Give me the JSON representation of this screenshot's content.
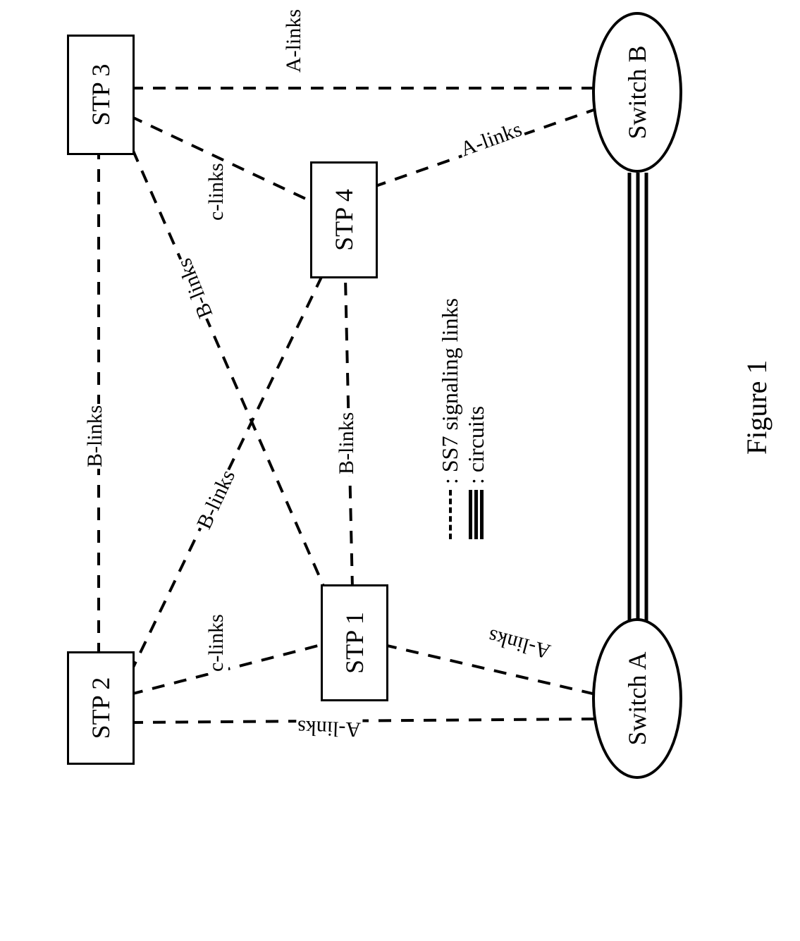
{
  "chart_data": {
    "type": "diagram",
    "title": "Figure 1",
    "nodes": [
      {
        "id": "stp1",
        "label": "STP 1",
        "shape": "rect"
      },
      {
        "id": "stp2",
        "label": "STP 2",
        "shape": "rect"
      },
      {
        "id": "stp3",
        "label": "STP 3",
        "shape": "rect"
      },
      {
        "id": "stp4",
        "label": "STP 4",
        "shape": "rect"
      },
      {
        "id": "switchA",
        "label": "Switch A",
        "shape": "ellipse"
      },
      {
        "id": "switchB",
        "label": "Switch B",
        "shape": "ellipse"
      }
    ],
    "edges": [
      {
        "from": "stp2",
        "to": "stp3",
        "type": "dashed",
        "label": "B-links"
      },
      {
        "from": "stp2",
        "to": "stp4",
        "type": "dashed",
        "label": "B-links"
      },
      {
        "from": "stp1",
        "to": "stp3",
        "type": "dashed",
        "label": "B-links"
      },
      {
        "from": "stp1",
        "to": "stp4",
        "type": "dashed",
        "label": "B-links"
      },
      {
        "from": "stp1",
        "to": "stp2",
        "type": "dashed",
        "label": "c-links"
      },
      {
        "from": "stp3",
        "to": "stp4",
        "type": "dashed",
        "label": "c-links"
      },
      {
        "from": "stp2",
        "to": "switchA",
        "type": "dashed",
        "label": "A-links"
      },
      {
        "from": "stp1",
        "to": "switchA",
        "type": "dashed",
        "label": "A-links"
      },
      {
        "from": "stp3",
        "to": "switchB",
        "type": "dashed",
        "label": "A-links"
      },
      {
        "from": "stp4",
        "to": "switchB",
        "type": "dashed",
        "label": "A-links"
      },
      {
        "from": "switchA",
        "to": "switchB",
        "type": "solid",
        "count": 3
      }
    ],
    "legend": [
      {
        "style": "dashed",
        "label": ": SS7 signaling links"
      },
      {
        "style": "solid",
        "label": ": circuits"
      }
    ]
  },
  "nodes": {
    "stp1": "STP 1",
    "stp2": "STP 2",
    "stp3": "STP 3",
    "stp4": "STP 4",
    "switchA": "Switch A",
    "switchB": "Switch B"
  },
  "labels": {
    "blinks": "B-links",
    "clinks": "c-links",
    "alinks": "A-links"
  },
  "legend": {
    "signaling": ": SS7 signaling links",
    "circuits": ": circuits"
  },
  "figure": "Figure 1"
}
